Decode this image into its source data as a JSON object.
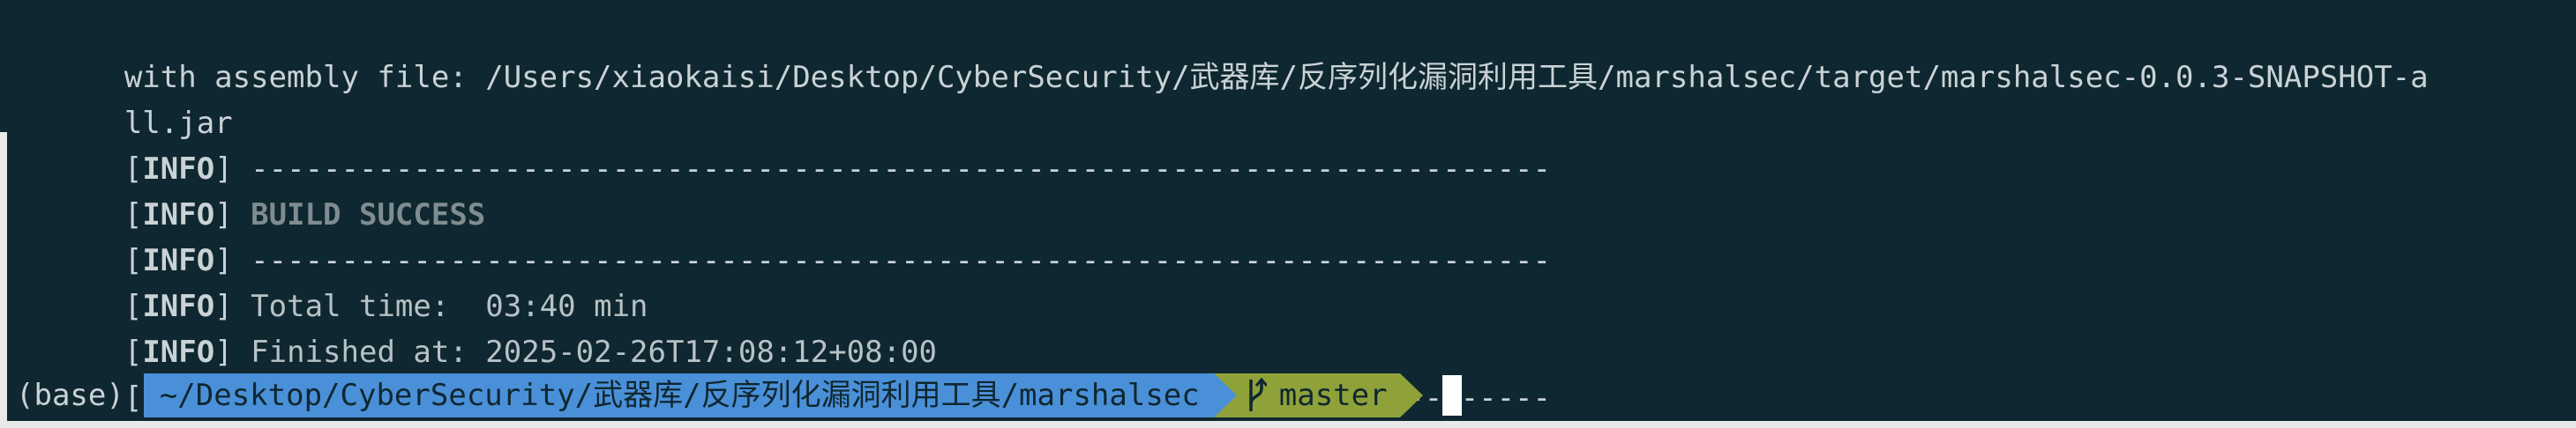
{
  "terminal": {
    "lines": {
      "assembly_1": "with assembly file: /Users/xiaokaisi/Desktop/CyberSecurity/武器库/反序列化漏洞利用工具/marshalsec/target/marshalsec-0.0.3-SNAPSHOT-a",
      "assembly_2": "ll.jar",
      "info_label": "INFO",
      "dashes": "------------------------------------------------------------------------",
      "build_success": "BUILD SUCCESS",
      "total_time": "Total time:  03:40 min",
      "finished_at": "Finished at: 2025-02-26T17:08:12+08:00"
    }
  },
  "prompt": {
    "env": "(base)",
    "path": "~/Desktop/CyberSecurity/武器库/反序列化漏洞利用工具/marshalsec",
    "branch": "master",
    "branch_icon": "git-branch-icon"
  },
  "colors": {
    "background": "#0f2730",
    "path_segment": "#4a90d9",
    "git_segment": "#8fa23a",
    "text": "#c9d2d5"
  }
}
